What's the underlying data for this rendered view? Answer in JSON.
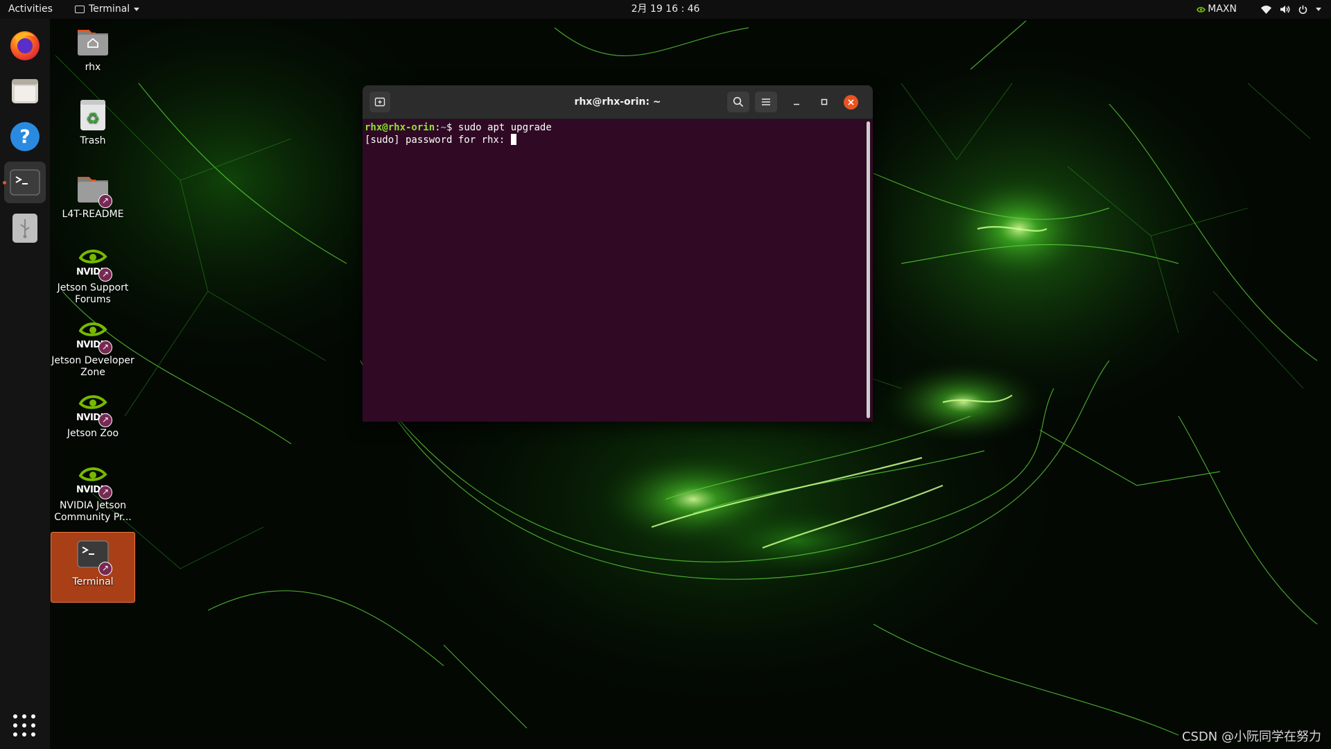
{
  "topbar": {
    "activities": "Activities",
    "app_menu_label": "Terminal",
    "clock": "2月 19 16 : 46",
    "power_mode": "MAXN"
  },
  "dock": {
    "items": [
      {
        "name": "Firefox",
        "icon": "firefox-icon"
      },
      {
        "name": "Files",
        "icon": "files-icon"
      },
      {
        "name": "Help",
        "icon": "help-icon"
      },
      {
        "name": "Terminal",
        "icon": "terminal-icon",
        "running": true
      },
      {
        "name": "USB Drive",
        "icon": "usb-icon"
      }
    ],
    "show_apps_icon": "app-grid-icon"
  },
  "desktop": {
    "icons": [
      {
        "label": "rhx",
        "icon": "home-folder-icon"
      },
      {
        "label": "Trash",
        "icon": "trash-icon"
      },
      {
        "label": "L4T-README",
        "icon": "folder-link-icon"
      },
      {
        "label": "Jetson Support Forums",
        "icon": "nvidia-icon"
      },
      {
        "label": "Jetson Developer Zone",
        "icon": "nvidia-icon"
      },
      {
        "label": "Jetson Zoo",
        "icon": "nvidia-icon"
      },
      {
        "label": "NVIDIA Jetson Community Pr...",
        "icon": "nvidia-icon"
      },
      {
        "label": "Terminal",
        "icon": "terminal-icon",
        "selected": true
      }
    ],
    "nvidia_wordmark": "NVIDIA"
  },
  "terminal": {
    "title": "rhx@rhx-orin: ~",
    "prompt_user": "rhx@rhx-orin",
    "prompt_sep": ":",
    "prompt_path": "~",
    "prompt_symbol": "$ ",
    "command": "sudo apt upgrade",
    "output_line": "[sudo] password for rhx: "
  },
  "watermark": "CSDN @小阮同学在努力",
  "colors": {
    "terminal_bg": "#300a24",
    "accent": "#e95420",
    "prompt_user": "#8ae234",
    "prompt_path": "#729fcf",
    "nvidia_green": "#76b900"
  }
}
